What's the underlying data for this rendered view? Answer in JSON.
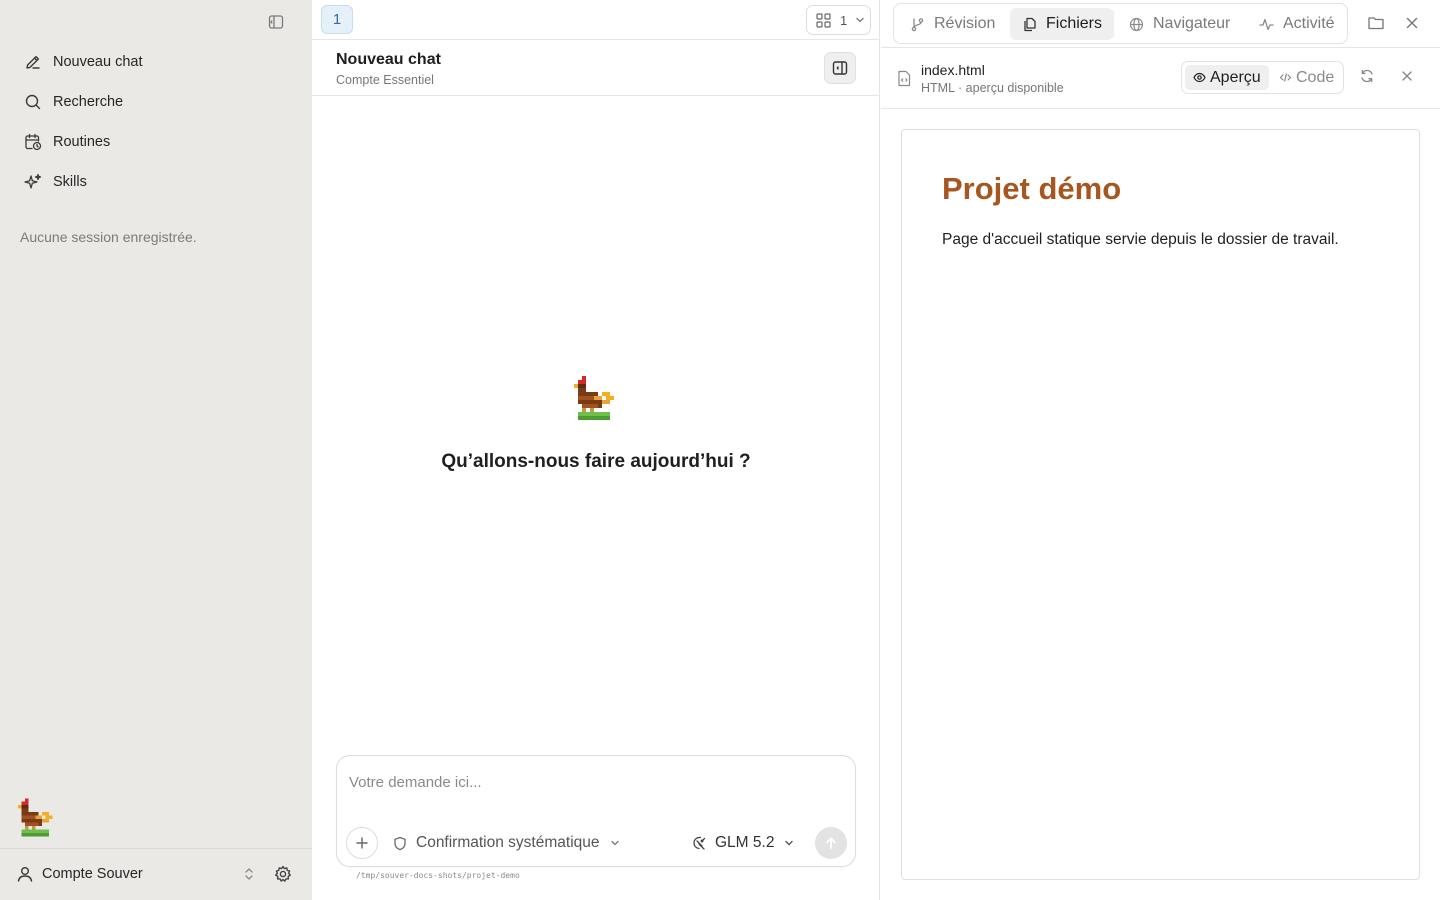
{
  "sidebar": {
    "items": [
      {
        "label": "Nouveau chat",
        "icon": "pencil-icon"
      },
      {
        "label": "Recherche",
        "icon": "search-icon"
      },
      {
        "label": "Routines",
        "icon": "calendar-clock-icon"
      },
      {
        "label": "Skills",
        "icon": "sparkles-icon"
      }
    ],
    "empty_text": "Aucune session enregistrée.",
    "account": {
      "label": "Compte Souver",
      "icon": "user-icon"
    }
  },
  "chat": {
    "workspace_tab": "1",
    "workspace_count": "1",
    "title": "Nouveau chat",
    "subtitle": "Compte Essentiel",
    "welcome": "Qu’allons-nous faire aujourd’hui ?",
    "composer": {
      "placeholder": "Votre demande ici...",
      "mode": "Confirmation systématique",
      "model": "GLM 5.2"
    },
    "path": "/tmp/souver-docs-shots/projet-demo"
  },
  "panel": {
    "tabs": [
      {
        "label": "Révision",
        "icon": "git-branch-icon",
        "active": false
      },
      {
        "label": "Fichiers",
        "icon": "files-icon",
        "active": true
      },
      {
        "label": "Navigateur",
        "icon": "globe-icon",
        "active": false
      },
      {
        "label": "Activité",
        "icon": "activity-icon",
        "active": false
      }
    ],
    "file": {
      "name": "index.html",
      "meta": "HTML · aperçu disponible"
    },
    "view_modes": {
      "preview": "Aperçu",
      "code": "Code",
      "selected": "Aperçu"
    },
    "preview": {
      "title": "Projet démo",
      "text": "Page d'accueil statique servie depuis le dossier de travail."
    }
  },
  "colors": {
    "sidebar_bg": "#ebe9e5",
    "preview_title": "#a8561f",
    "active_tab_bg": "#efefef",
    "workspace_tab_accent": "#2c6db3"
  }
}
